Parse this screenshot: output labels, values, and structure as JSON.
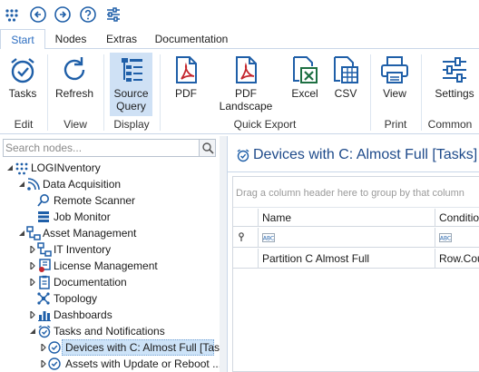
{
  "toolbar": {
    "icons": [
      "app-grid-icon",
      "back-icon",
      "forward-icon",
      "help-icon",
      "settings-sliders-icon"
    ]
  },
  "tabs": [
    {
      "label": "Start",
      "active": true
    },
    {
      "label": "Nodes",
      "active": false
    },
    {
      "label": "Extras",
      "active": false
    },
    {
      "label": "Documentation",
      "active": false
    }
  ],
  "ribbon": {
    "tasks": "Tasks",
    "refresh": "Refresh",
    "source_query": "Source Query",
    "pdf": "PDF",
    "pdf_landscape": "PDF Landscape",
    "excel": "Excel",
    "csv": "CSV",
    "view": "View",
    "settings": "Settings",
    "groups": {
      "edit": "Edit",
      "view": "View",
      "display": "Display",
      "quick_export": "Quick Export",
      "print": "Print",
      "common": "Common"
    }
  },
  "search": {
    "placeholder": "Search nodes...",
    "value": ""
  },
  "tree": {
    "root": "LOGINventory",
    "data_acquisition": "Data Acquisition",
    "remote_scanner": "Remote Scanner",
    "job_monitor": "Job Monitor",
    "asset_management": "Asset Management",
    "it_inventory": "IT Inventory",
    "license_management": "License Management",
    "documentation": "Documentation",
    "topology": "Topology",
    "dashboards": "Dashboards",
    "tasks_notifications": "Tasks and Notifications",
    "devices_c_full": "Devices with C: Almost Full [Tas...",
    "assets_update_reboot": "Assets with Update or Reboot ..."
  },
  "panel": {
    "title": "Devices with C: Almost Full [Tasks]",
    "group_hint": "Drag a column header here to group by that column",
    "columns": [
      "Name",
      "Condition"
    ],
    "filter_placeholder": "ABC",
    "rows": [
      {
        "name": "Partition C Almost Full",
        "condition": "Row.Cour"
      }
    ]
  },
  "colors": {
    "accent": "#2a6cc0",
    "title_blue": "#1e4a8a",
    "selection": "#cde3f8",
    "icon_blue": "#1f5fa8",
    "pdf_red": "#c4262e",
    "excel_green": "#1d6f42"
  }
}
